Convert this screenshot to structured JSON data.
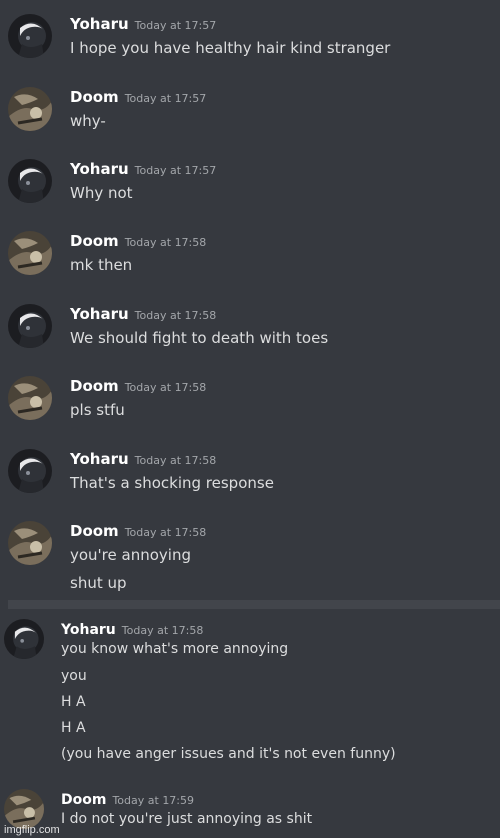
{
  "messages": [
    {
      "author": "Yoharu",
      "avatar": "yoharu-avatar",
      "time": "Today at 17:57",
      "lines": [
        "I hope you have healthy hair  kind stranger"
      ]
    },
    {
      "author": "Doom",
      "avatar": "doom-avatar",
      "time": "Today at 17:57",
      "lines": [
        "why-"
      ]
    },
    {
      "author": "Yoharu",
      "avatar": "yoharu-avatar",
      "time": "Today at 17:57",
      "lines": [
        "Why not"
      ]
    },
    {
      "author": "Doom",
      "avatar": "doom-avatar",
      "time": "Today at 17:58",
      "lines": [
        "mk then"
      ]
    },
    {
      "author": "Yoharu",
      "avatar": "yoharu-avatar",
      "time": "Today at 17:58",
      "lines": [
        "We should fight to death with toes"
      ]
    },
    {
      "author": "Doom",
      "avatar": "doom-avatar",
      "time": "Today at 17:58",
      "lines": [
        "pls stfu"
      ]
    },
    {
      "author": "Yoharu",
      "avatar": "yoharu-avatar",
      "time": "Today at 17:58",
      "lines": [
        "That's a shocking response"
      ]
    },
    {
      "author": "Doom",
      "avatar": "doom-avatar",
      "time": "Today at 17:58",
      "lines": [
        "you're annoying",
        "shut up"
      ]
    },
    {
      "author": "Yoharu",
      "avatar": "yoharu-avatar",
      "time": "Today at 17:58",
      "lines": [
        "you know what's more annoying",
        "you",
        "H A",
        "H A",
        "(you have anger issues and it's not even funny)"
      ]
    },
    {
      "author": "Doom",
      "avatar": "doom-avatar",
      "time": "Today at 17:59",
      "lines": [
        "I do not you're just annoying as shit"
      ]
    }
  ],
  "watermark": "imgflip.com",
  "colors": {
    "background": "#36393f",
    "username": "#ffffff",
    "message_text": "#dcddde",
    "timestamp": "#a3a6aa"
  }
}
